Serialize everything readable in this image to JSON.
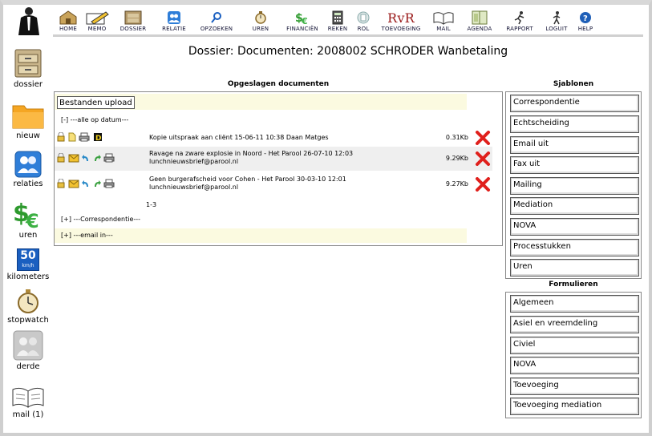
{
  "sidebar": {
    "items": [
      {
        "label": "dossier"
      },
      {
        "label": "nieuw"
      },
      {
        "label": "relaties"
      },
      {
        "label": "uren"
      },
      {
        "label": "kilometers",
        "icon_text_top": "50",
        "icon_text_bottom": "km/h"
      },
      {
        "label": "stopwatch"
      },
      {
        "label": "derde"
      },
      {
        "label": "mail (1)"
      }
    ]
  },
  "toolbar": {
    "items": [
      {
        "label": "HOME"
      },
      {
        "label": "MEMO"
      },
      {
        "label": "DOSSIER"
      },
      {
        "label": "RELATIE"
      },
      {
        "label": "OPZOEKEN"
      },
      {
        "label": "UREN"
      },
      {
        "label": "FINANCIËN"
      },
      {
        "label": "REKEN"
      },
      {
        "label": "ROL"
      },
      {
        "label": "TOEVOEGING",
        "icon_text": "RvR"
      },
      {
        "label": "MAIL"
      },
      {
        "label": "AGENDA"
      },
      {
        "label": "RAPPORT"
      },
      {
        "label": "LOGUIT"
      },
      {
        "label": "HELP"
      }
    ]
  },
  "page": {
    "title": "Dossier: Documenten: 2008002 SCHRODER Wanbetaling"
  },
  "documents": {
    "section_title": "Opgeslagen documenten",
    "upload_label": "Bestanden upload",
    "group_all": "[-] ---alle op datum---",
    "rows": [
      {
        "title_line1": "Kopie uitspraak aan cliënt 15-06-11 10:38 Daan Matges",
        "title_line2": "",
        "size": "0.31Kb"
      },
      {
        "title_line1": "Ravage na zware explosie in Noord - Het Parool 26-07-10 12:03",
        "title_line2": "lunchnieuwsbrief@parool.nl",
        "size": "9.29Kb"
      },
      {
        "title_line1": "Geen burgerafscheid voor Cohen - Het Parool 30-03-10 12:01",
        "title_line2": "lunchnieuwsbrief@parool.nl",
        "size": "9.27Kb"
      }
    ],
    "pager": "1-3",
    "group_correspondentie": "[+] ---Correspondentie---",
    "group_email": "[+] ---email in---"
  },
  "templates": {
    "title": "Sjablonen",
    "items": [
      "Correspondentie",
      "Echtscheiding",
      "Email uit",
      "Fax uit",
      "Mailing",
      "Mediation",
      "NOVA",
      "Processtukken",
      "Uren"
    ]
  },
  "forms": {
    "title": "Formulieren",
    "items": [
      "Algemeen",
      "Asiel en vreemdeling",
      "Civiel",
      "NOVA",
      "Toevoeging",
      "Toevoeging mediation"
    ]
  },
  "colors": {
    "delete": "#e0201c",
    "row_highlight": "#efefef",
    "group_bg": "#fbfae0",
    "frame": "#cfcfcf"
  }
}
